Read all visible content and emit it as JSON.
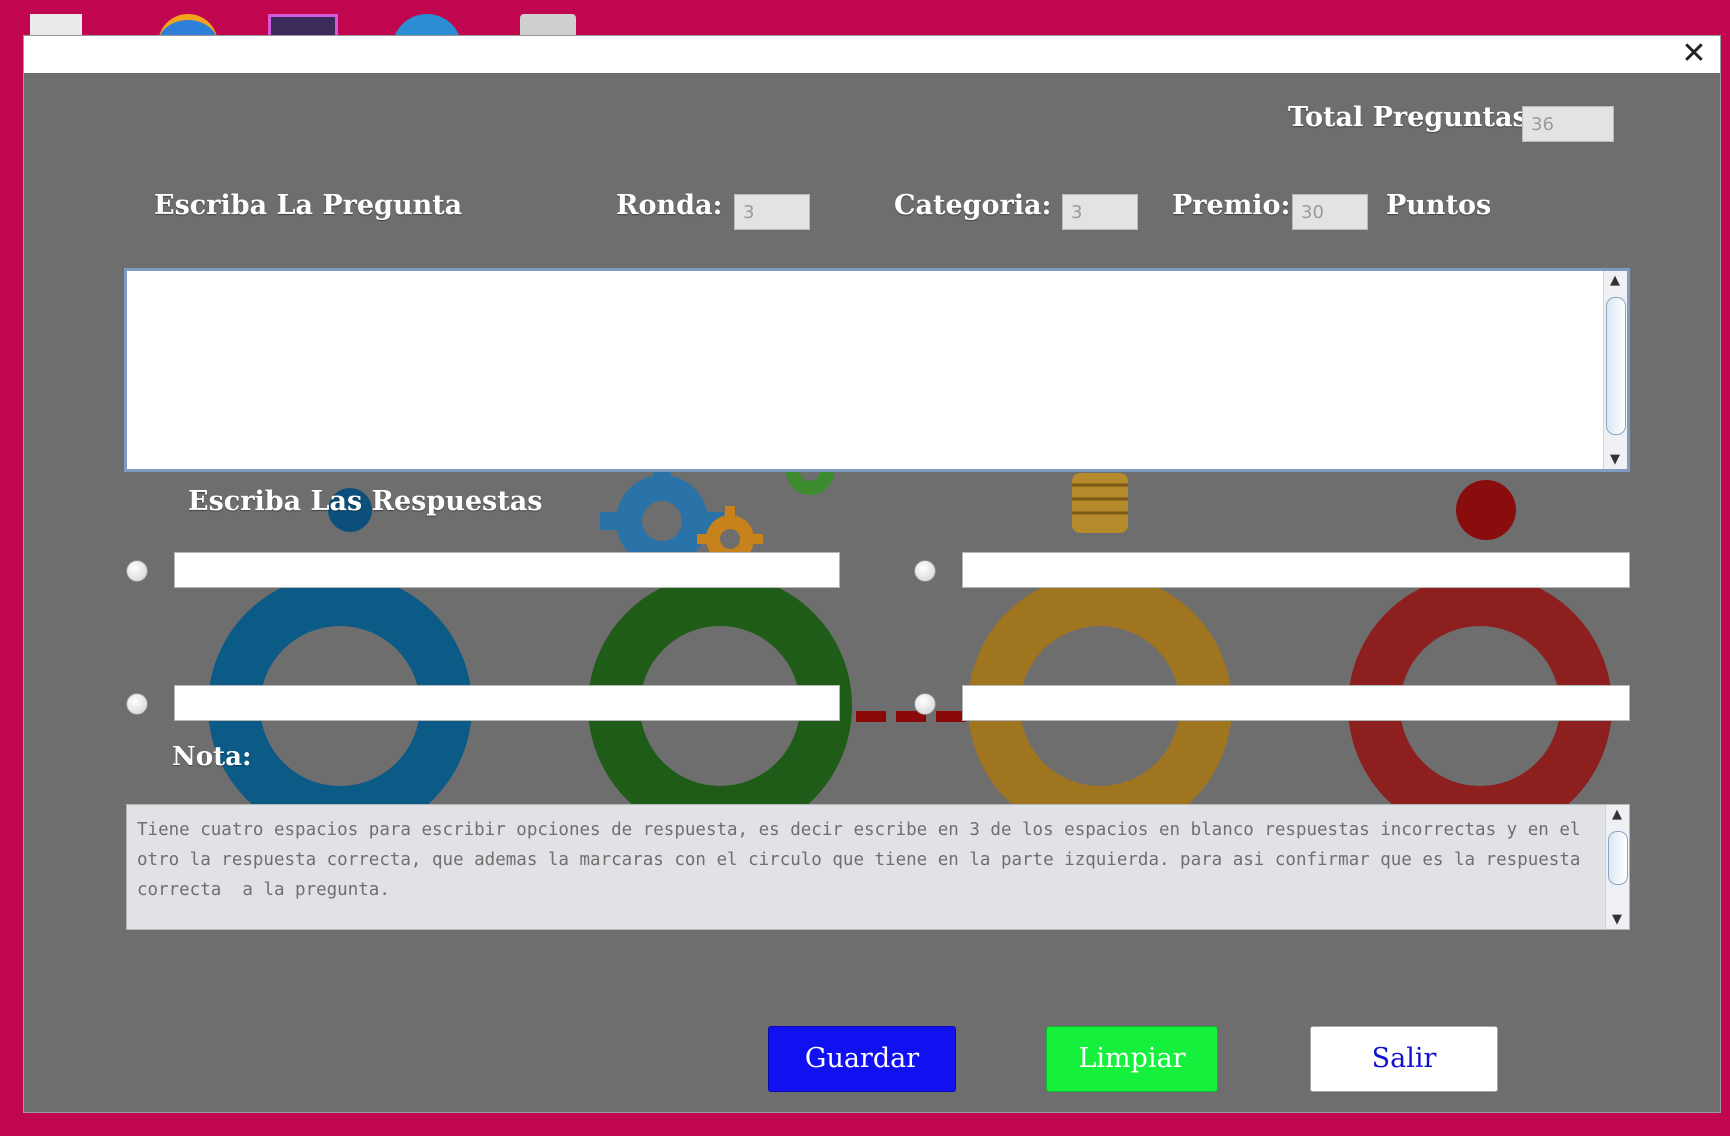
{
  "window": {
    "close_glyph": "✕"
  },
  "header": {
    "total_label": "Total Preguntas:",
    "total_value": "36"
  },
  "question": {
    "heading": "Escriba La Pregunta",
    "ronda_label": "Ronda:",
    "ronda_value": "3",
    "categoria_label": "Categoria:",
    "categoria_value": "3",
    "premio_label": "Premio:",
    "premio_value": "30",
    "puntos_label": "Puntos",
    "text": ""
  },
  "answers": {
    "heading": "Escriba Las Respuestas",
    "items": [
      {
        "value": ""
      },
      {
        "value": ""
      },
      {
        "value": ""
      },
      {
        "value": ""
      }
    ]
  },
  "note": {
    "label": "Nota:",
    "text": "Tiene cuatro espacios para escribir opciones de respuesta, es decir escribe en 3 de los espacios en blanco respuestas incorrectas y en el otro la respuesta correcta, que ademas la marcaras con el circulo que tiene en la parte izquierda. para asi confirmar que es la respuesta correcta  a la pregunta."
  },
  "buttons": {
    "save": "Guardar",
    "clear": "Limpiar",
    "exit": "Salir"
  },
  "colors": {
    "desktop": "#c0064e",
    "window_bg": "#6e6e6e",
    "save_bg": "#1010f0",
    "clear_bg": "#14f03c",
    "exit_bg": "#ffffff",
    "ring_blue": "#0b5b86",
    "ring_green": "#1f5c17",
    "ring_yellow": "#a07520",
    "ring_red": "#8d1f1f"
  },
  "icons": {
    "close": "close-icon",
    "scroll_up": "scroll-up-arrow-icon",
    "scroll_down": "scroll-down-arrow-icon",
    "background": "gears-lightbulb-process-illustration"
  }
}
